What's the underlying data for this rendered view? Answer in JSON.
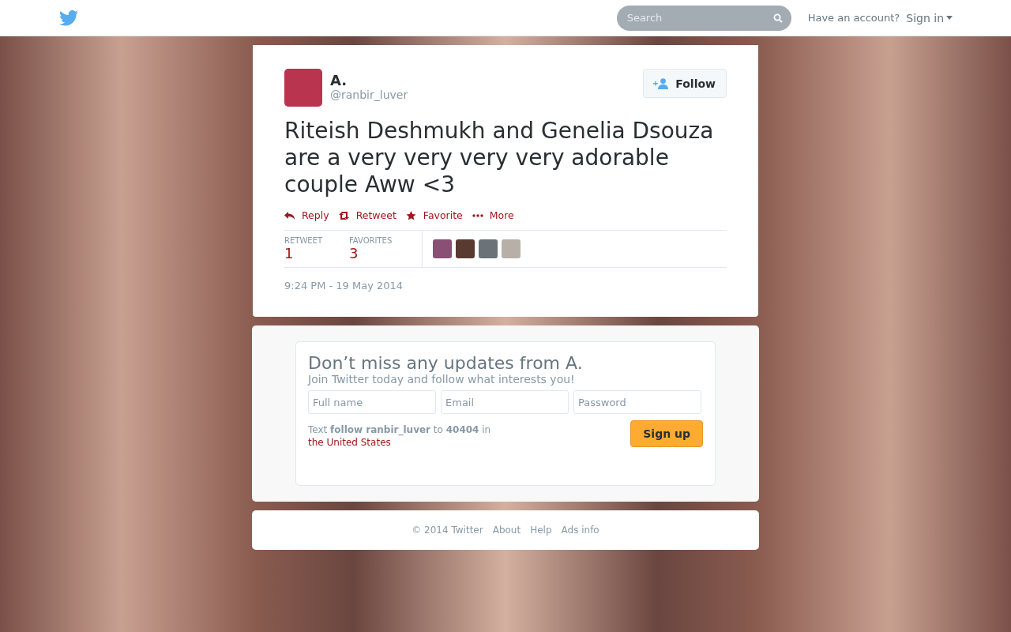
{
  "top_bar": {
    "search": {
      "placeholder": "Search"
    },
    "account_prompt": "Have an account?",
    "sign_in": "Sign in"
  },
  "tweet": {
    "author": {
      "name": "A.",
      "handle": "@ranbir_luver"
    },
    "follow_button": "Follow",
    "text": "Riteish Deshmukh and Genelia Dsouza are a very very very very adorable couple Aww <3",
    "actions": [
      {
        "kind": "reply",
        "label": "Reply"
      },
      {
        "kind": "retweet",
        "label": "Retweet"
      },
      {
        "kind": "favorite",
        "label": "Favorite"
      },
      {
        "kind": "more",
        "label": "More"
      }
    ],
    "stats": [
      {
        "label": "RETWEET",
        "value": "1"
      },
      {
        "label": "FAVORITES",
        "value": "3"
      }
    ],
    "favoriters": [
      {
        "kind": "photo"
      },
      {
        "kind": "photo"
      },
      {
        "kind": "photo"
      },
      {
        "kind": "photo"
      }
    ],
    "timestamp": "9:24 PM - 19 May 2014"
  },
  "signup": {
    "title": "Don’t miss any updates from A.",
    "subtitle": "Join Twitter today and follow what interests you!",
    "fields": [
      {
        "placeholder": "Full name"
      },
      {
        "placeholder": "Email"
      },
      {
        "placeholder": "Password"
      }
    ],
    "sms_text": "Text **follow ranbir_luver** to **40404** in",
    "sms_link": "the United States",
    "button": "Sign up"
  },
  "footer": {
    "copyright": "© 2014 Twitter",
    "links": [
      "About",
      "Help",
      "Ads info"
    ]
  }
}
